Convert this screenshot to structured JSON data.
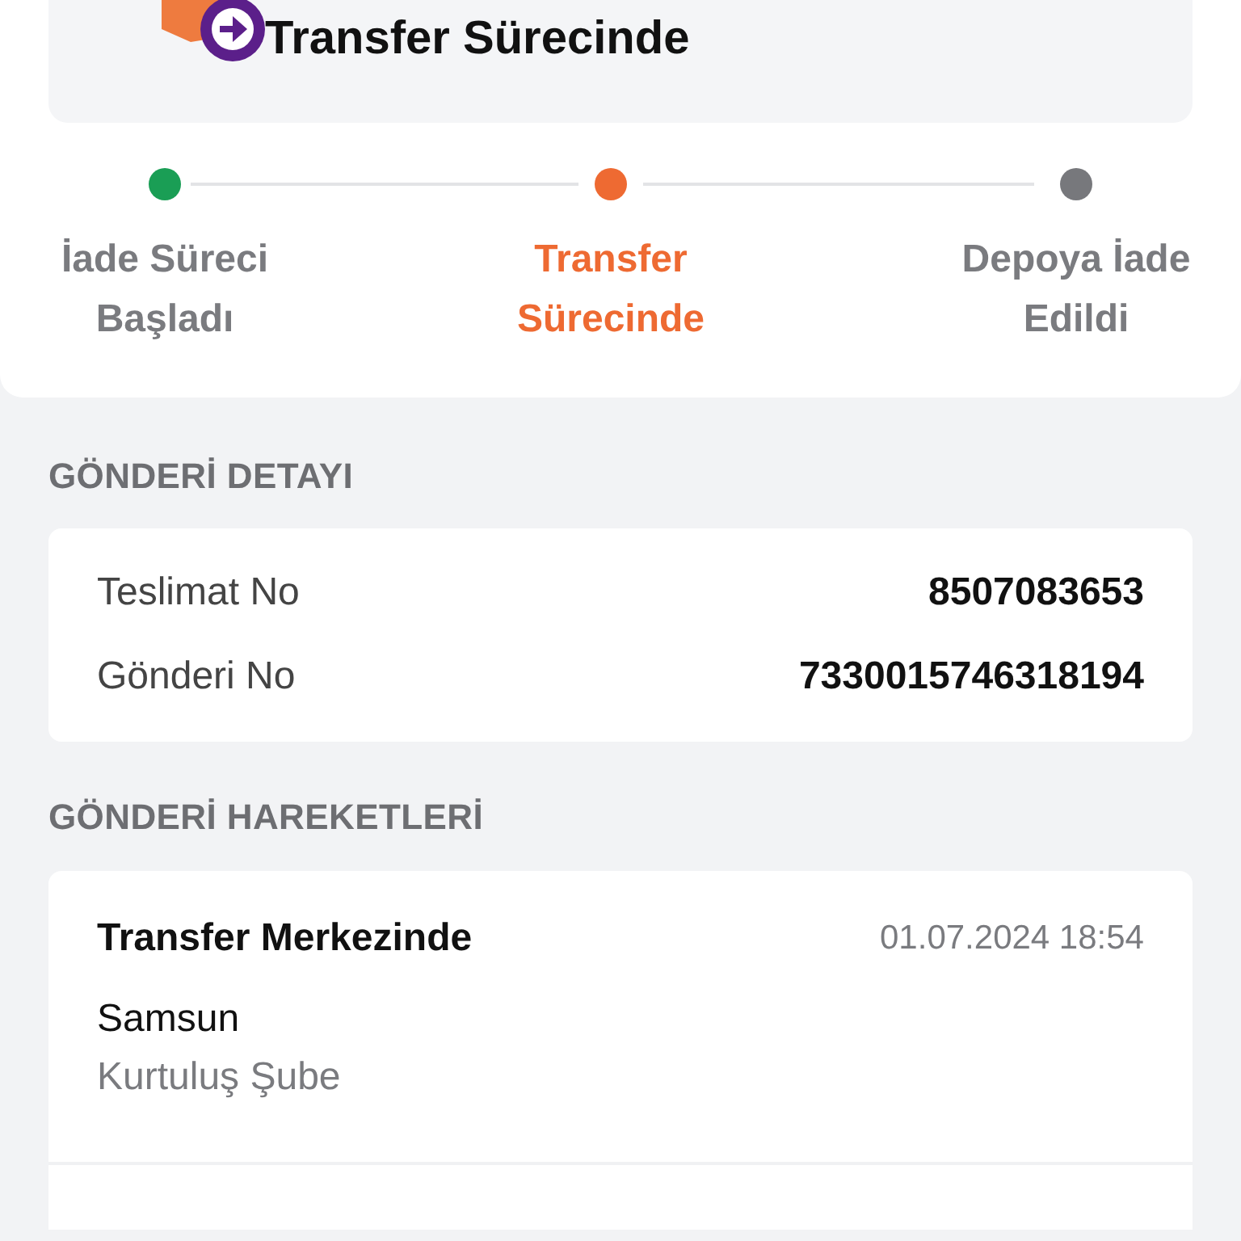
{
  "status": {
    "title": "Transfer Sürecinde"
  },
  "steps": [
    {
      "label": "İade Süreci Başladı",
      "color": "#1a9e55",
      "selected": false
    },
    {
      "label": "Transfer Sürecinde",
      "color": "#ee6a32",
      "selected": true
    },
    {
      "label": "Depoya İade Edildi",
      "color": "#77787c",
      "selected": false
    }
  ],
  "shipment_detail": {
    "heading": "GÖNDERİ DETAYI",
    "rows": [
      {
        "label": "Teslimat No",
        "value": "8507083653"
      },
      {
        "label": "Gönderi No",
        "value": "7330015746318194"
      }
    ]
  },
  "shipment_movements": {
    "heading": "GÖNDERİ HAREKETLERİ",
    "items": [
      {
        "title": "Transfer Merkezinde",
        "time": "01.07.2024 18:54",
        "city": "Samsun",
        "branch": "Kurtuluş Şube"
      }
    ]
  }
}
